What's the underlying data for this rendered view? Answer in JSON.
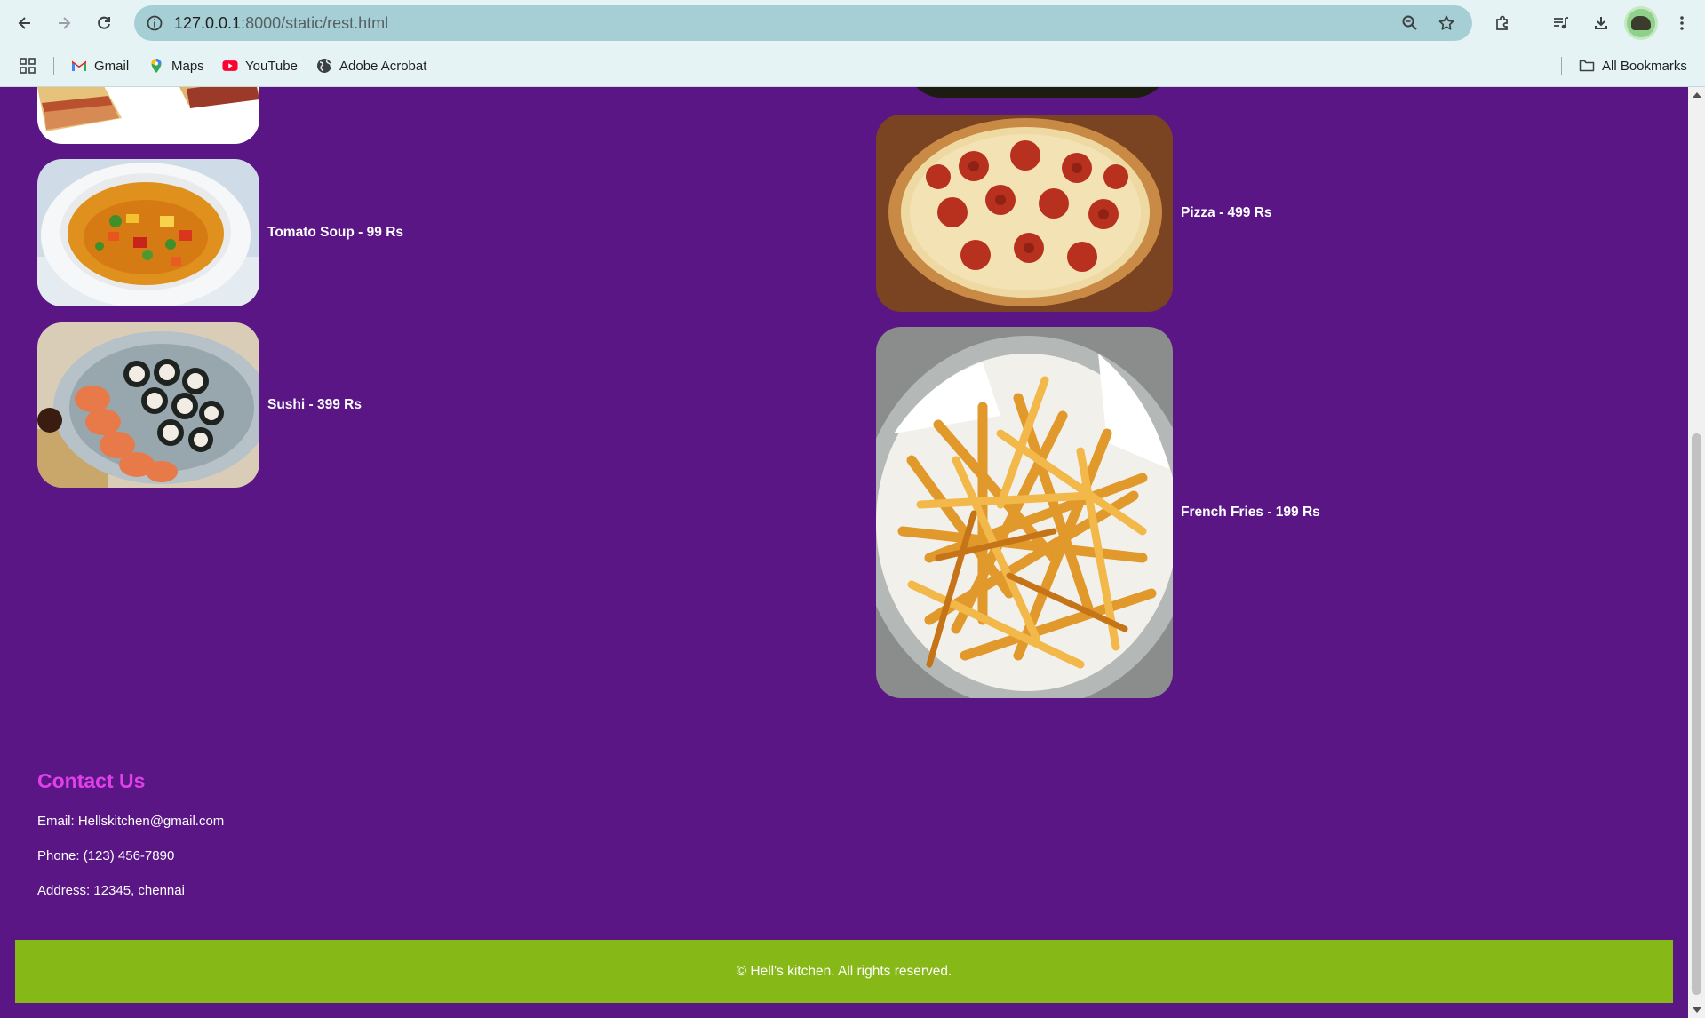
{
  "browser": {
    "url_host": "127.0.0.1",
    "url_rest": ":8000/static/rest.html",
    "bookmarks": [
      {
        "label": "Gmail",
        "icon": "gmail-icon"
      },
      {
        "label": "Maps",
        "icon": "maps-icon"
      },
      {
        "label": "YouTube",
        "icon": "youtube-icon"
      },
      {
        "label": "Adobe Acrobat",
        "icon": "globe-icon"
      }
    ],
    "all_bookmarks_label": "All Bookmarks"
  },
  "colors": {
    "page_background": "#5a1685",
    "footer_background": "#86b817",
    "contact_heading": "#e040e8"
  },
  "menu": {
    "left": [
      {
        "label": "Tomato Soup - 99 Rs",
        "image": "tomato-soup"
      },
      {
        "label": "Sushi - 399 Rs",
        "image": "sushi"
      }
    ],
    "right": [
      {
        "label": "Pizza - 499 Rs",
        "image": "pizza"
      },
      {
        "label": "French Fries - 199 Rs",
        "image": "french-fries"
      }
    ]
  },
  "contact": {
    "title": "Contact Us",
    "email": "Email: Hellskitchen@gmail.com",
    "phone": "Phone: (123) 456-7890",
    "address": "Address: 12345, chennai"
  },
  "footer": {
    "text": "© Hell's kitchen. All rights reserved."
  }
}
